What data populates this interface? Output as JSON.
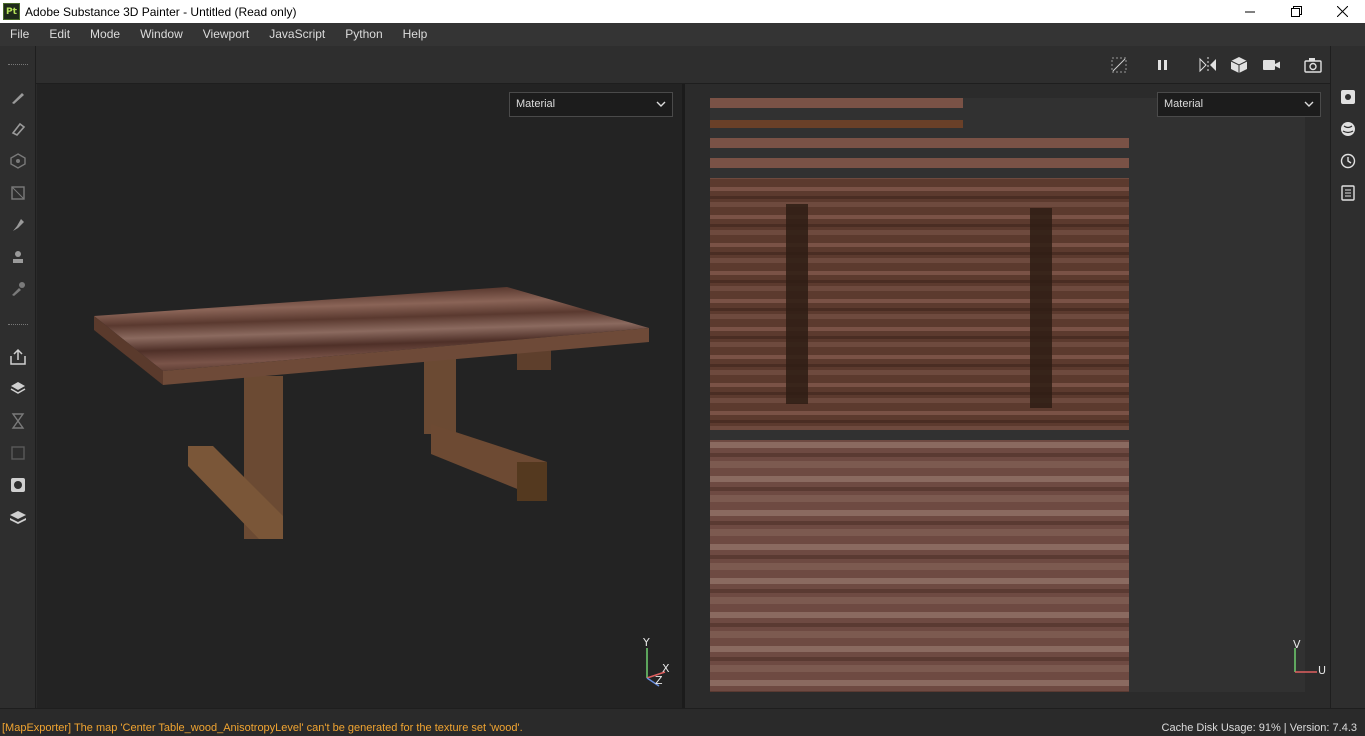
{
  "window": {
    "title": "Adobe Substance 3D Painter - Untitled (Read only)",
    "logo_text": "Pt"
  },
  "menu": [
    "File",
    "Edit",
    "Mode",
    "Window",
    "Viewport",
    "JavaScript",
    "Python",
    "Help"
  ],
  "viewport3d": {
    "mode_dropdown": "Material",
    "axis": {
      "y": "Y",
      "x": "X",
      "z": "Z"
    }
  },
  "viewport2d": {
    "mode_dropdown": "Material",
    "axis": {
      "v": "V",
      "u": "U"
    }
  },
  "status": {
    "message": "[MapExporter] The map 'Center Table_wood_AnisotropyLevel' can't be generated for the texture set 'wood'.",
    "cache_disk_usage": "Cache Disk Usage:   91% | Version: 7.4.3"
  },
  "colors": {
    "accent_warning": "#f0a431",
    "wood_light": "#7a5248",
    "wood_dark": "#4a2e24"
  }
}
